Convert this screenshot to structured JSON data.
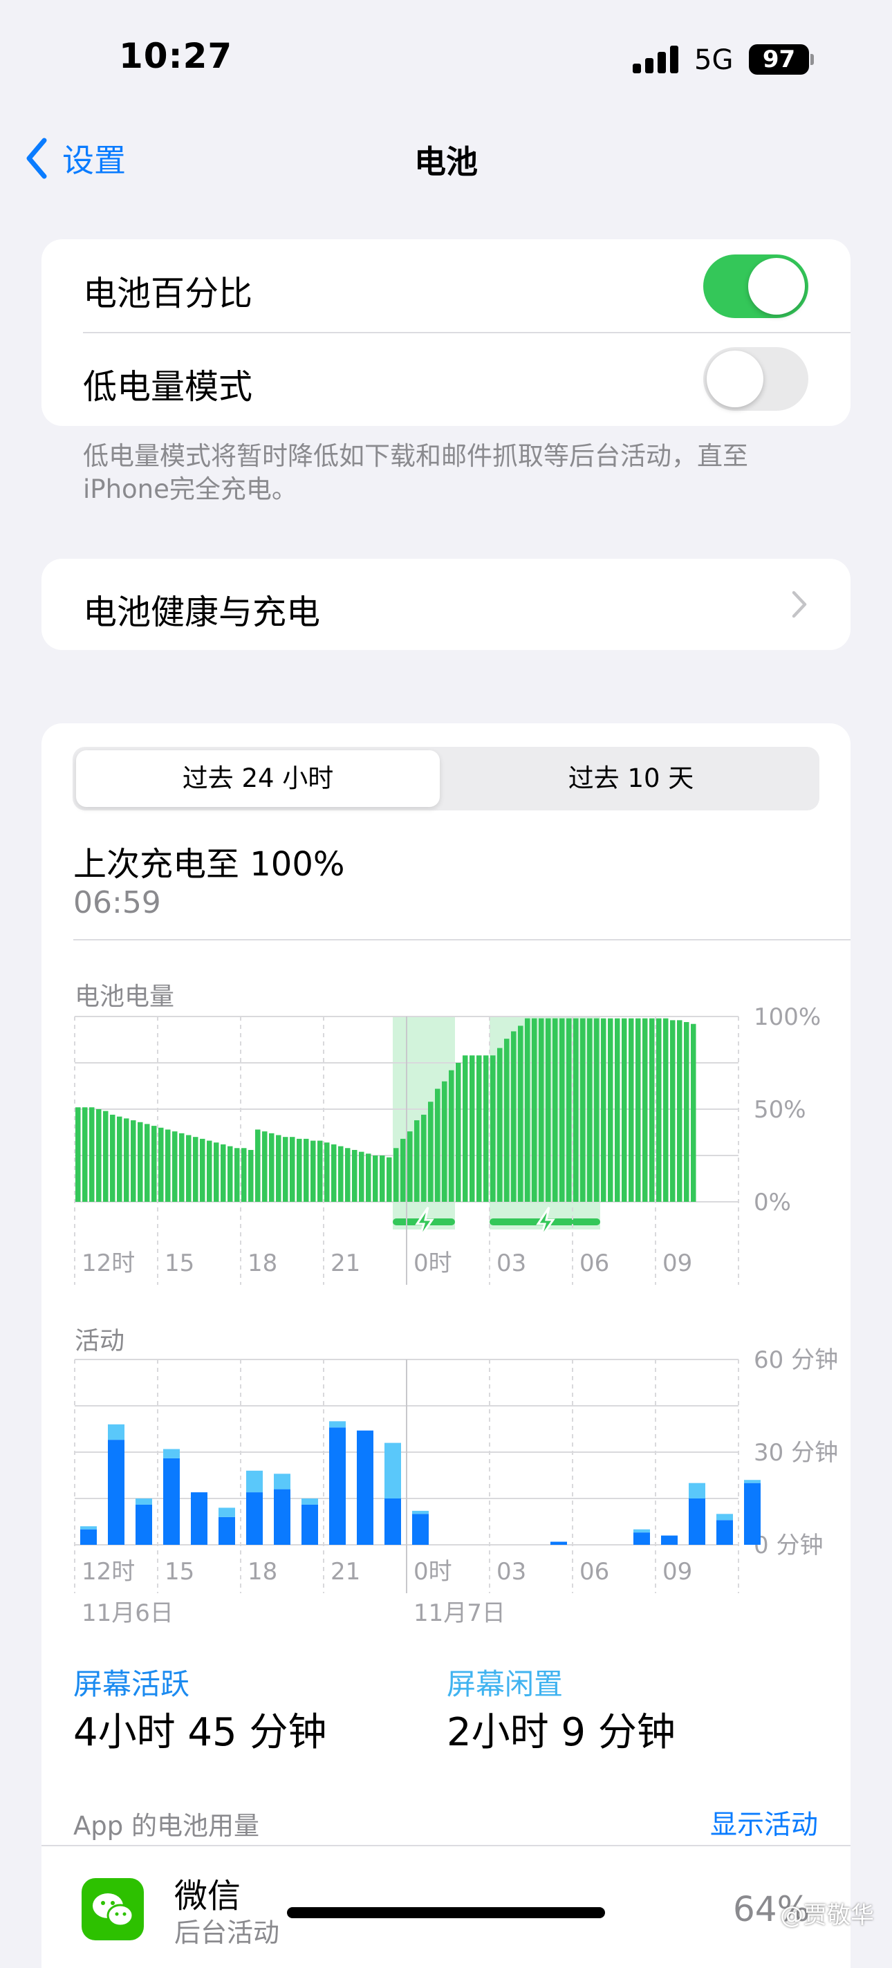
{
  "status_bar": {
    "time": "10:27",
    "network": "5G",
    "battery": "97"
  },
  "nav": {
    "back_label": "设置",
    "title": "电池"
  },
  "settings": {
    "battery_percentage": {
      "label": "电池百分比",
      "on": true
    },
    "low_power_mode": {
      "label": "低电量模式",
      "on": false
    },
    "low_power_note": "低电量模式将暂时降低如下载和邮件抓取等后台活动，直至iPhone完全充电。",
    "health_label": "电池健康与充电"
  },
  "usage": {
    "tabs": [
      {
        "label": "过去 24 小时",
        "selected": true
      },
      {
        "label": "过去 10 天",
        "selected": false
      }
    ],
    "last_charge_label": "上次充电至 100%",
    "last_charge_time": "06:59",
    "battery_level_title": "电池电量",
    "activity_title": "活动",
    "x_labels": [
      "12时",
      "15",
      "18",
      "21",
      "0时",
      "03",
      "06",
      "09"
    ],
    "dates": [
      "11月6日",
      "11月7日"
    ],
    "screen_on_label": "屏幕活跃",
    "screen_on_value": "4小时 45 分钟",
    "screen_idle_label": "屏幕闲置",
    "screen_idle_value": "2小时 9 分钟",
    "app_usage_label": "App 的电池用量",
    "show_activity_label": "显示活动",
    "apps": [
      {
        "name": "微信",
        "detail": "后台活动",
        "percent": "64%"
      }
    ]
  },
  "watermark": "@贾敬华",
  "colors": {
    "accent": "#0a7cff",
    "toggle_on": "#34c759",
    "battery_green": "#34c759",
    "activity_blue": "#0a7aff",
    "activity_light": "#5ac8fa"
  },
  "chart_data": [
    {
      "type": "bar",
      "title": "电池电量",
      "x_ticks": [
        "12时",
        "15",
        "18",
        "21",
        "0时",
        "03",
        "06",
        "09"
      ],
      "y_ticks": [
        "100%",
        "50%",
        "0%"
      ],
      "ylim": [
        0,
        100
      ],
      "values": [
        51,
        51,
        51,
        50,
        49,
        47,
        46,
        45,
        44,
        43,
        42,
        41,
        40,
        39,
        38,
        37,
        36,
        35,
        34,
        33,
        32,
        31,
        30,
        29,
        29,
        28,
        39,
        38,
        37,
        36,
        35,
        35,
        34,
        34,
        33,
        33,
        32,
        31,
        30,
        29,
        28,
        27,
        26,
        25,
        25,
        24,
        29,
        34,
        38,
        44,
        47,
        54,
        61,
        65,
        71,
        75,
        79,
        79,
        79,
        79,
        79,
        83,
        88,
        92,
        95,
        99,
        99,
        99,
        99,
        99,
        99,
        99,
        99,
        99,
        99,
        99,
        99,
        99,
        99,
        99,
        99,
        99,
        99,
        99,
        99,
        99,
        98,
        98,
        97,
        96
      ],
      "charging_ranges": [
        [
          46,
          55
        ],
        [
          60,
          76
        ]
      ]
    },
    {
      "type": "bar",
      "title": "活动",
      "x_ticks": [
        "12时",
        "15",
        "18",
        "21",
        "0时",
        "03",
        "06",
        "09"
      ],
      "y_ticks": [
        "60 分钟",
        "30 分钟",
        "0 分钟"
      ],
      "ylim": [
        0,
        60
      ],
      "series": [
        {
          "name": "屏幕活跃",
          "values": [
            5,
            34,
            13,
            28,
            17,
            9,
            17,
            18,
            13,
            38,
            37,
            15,
            10,
            0,
            0,
            0,
            0,
            1,
            0,
            0,
            4,
            3,
            15,
            8,
            20
          ]
        },
        {
          "name": "屏幕闲置",
          "values": [
            1,
            5,
            2,
            3,
            0,
            3,
            7,
            5,
            2,
            2,
            0,
            18,
            1,
            0,
            0,
            0,
            0,
            0,
            0,
            0,
            1,
            0,
            5,
            2,
            1
          ]
        }
      ]
    }
  ]
}
